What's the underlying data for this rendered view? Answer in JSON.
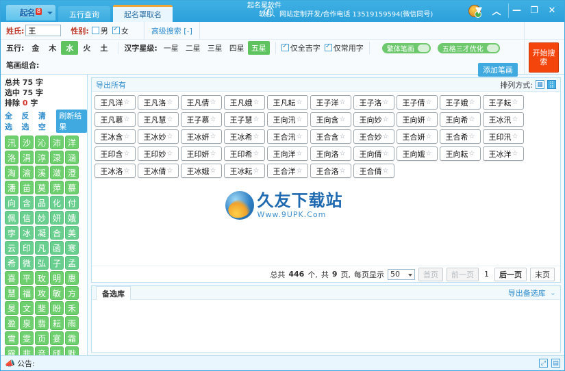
{
  "titlebar": {
    "logo_text": "起名",
    "logo_badge": "8",
    "tabs": [
      {
        "label": "五行查询",
        "active": false
      },
      {
        "label": "起名罩取名",
        "active": true
      }
    ],
    "promo_line1": "起名星软件",
    "promo_line2": "软件、网站定制开发/合作电话 13519159594(微信同号)",
    "phone_icon": "phone-icon",
    "qq_icon": "qq-status-icon",
    "win_buttons": [
      "▼",
      "︿",
      "—",
      "❐",
      "✕"
    ]
  },
  "search": {
    "surname_label": "姓氏:",
    "surname_value": "王",
    "gender_label": "性别:",
    "gender_male": "男",
    "gender_female": "女",
    "male_checked": false,
    "female_checked": true,
    "advanced_label": "高级搜索 [-]",
    "wuxing_label": "五行:",
    "wuxing_options": [
      "金",
      "木",
      "水",
      "火",
      "土"
    ],
    "wuxing_selected": "水",
    "star_label": "汉字星级:",
    "star_options": [
      "一星",
      "二星",
      "三星",
      "四星",
      "五星"
    ],
    "star_selected": "五星",
    "only_lucky": "仅全吉字",
    "only_lucky_checked": true,
    "only_common": "仅常用字",
    "only_common_checked": true,
    "toggle_traditional": "繁体笔画",
    "toggle_wuge": "五格三才优化",
    "stroke_label": "笔画组合:",
    "add_stroke_button": "添加笔画",
    "search_button": "开始搜索"
  },
  "sidebar": {
    "total_label": "总共",
    "total_value": "75",
    "total_unit": "字",
    "selected_label": "选中",
    "selected_value": "75",
    "selected_unit": "字",
    "excluded_label": "排除",
    "excluded_value": "0",
    "excluded_unit": "字",
    "select_all": "全选",
    "invert": "反选",
    "clear": "清空",
    "refresh": "刷新结果",
    "characters": [
      "汛",
      "沙",
      "沁",
      "沛",
      "洋",
      "洛",
      "涓",
      "淳",
      "渌",
      "涵",
      "淘",
      "渝",
      "溪",
      "潋",
      "澄",
      "潘",
      "苗",
      "莫",
      "萍",
      "慕",
      "向",
      "含",
      "品",
      "化",
      "付",
      "佩",
      "信",
      "妙",
      "妍",
      "娥",
      "孛",
      "冰",
      "凝",
      "合",
      "美",
      "云",
      "印",
      "凡",
      "函",
      "寒",
      "希",
      "微",
      "弘",
      "子",
      "孟",
      "喜",
      "平",
      "玫",
      "明",
      "惠",
      "慧",
      "福",
      "攻",
      "敏",
      "方",
      "旻",
      "文",
      "斐",
      "盼",
      "禾",
      "盈",
      "泉",
      "翡",
      "耘",
      "雨",
      "雪",
      "雯",
      "页",
      "宴",
      "霜",
      "露",
      "非",
      "音",
      "颀",
      "默"
    ]
  },
  "results": {
    "export_all": "导出所有",
    "sort_label": "排列方式:",
    "sort_icon_grid": "grid-view-icon",
    "sort_icon_list": "list-view-icon",
    "names": [
      "王凡洋",
      "王凡洛",
      "王凡倩",
      "王凡娥",
      "王凡耘",
      "王子洋",
      "王子洛",
      "王子倩",
      "王子娥",
      "王子耘",
      "王凡慕",
      "王凡慧",
      "王子慕",
      "王子慧",
      "王向汛",
      "王向含",
      "王向妙",
      "王向妍",
      "王向希",
      "王冰汛",
      "王冰含",
      "王冰妙",
      "王冰妍",
      "王冰希",
      "王合汛",
      "王合含",
      "王合妙",
      "王合妍",
      "王合希",
      "王印汛",
      "王印含",
      "王印妙",
      "王印妍",
      "王印希",
      "王向洋",
      "王向洛",
      "王向倩",
      "王向娥",
      "王向耘",
      "王冰洋",
      "王冰洛",
      "王冰倩",
      "王冰娥",
      "王冰耘",
      "王合洋",
      "王合洛",
      "王合倩"
    ],
    "star_glyph": "☆"
  },
  "watermark": {
    "cn": "久友下载站",
    "en": "Www.9UPK.Com"
  },
  "pager": {
    "total_prefix": "总共",
    "total_count": "446",
    "total_unit": "个,",
    "pages_prefix": "共",
    "pages_count": "9",
    "pages_unit": "页,",
    "per_page_label": "每页显示",
    "per_page_value": "50",
    "first": "首页",
    "prev": "前一页",
    "current": "1",
    "next": "后一页",
    "last": "末页"
  },
  "favorites": {
    "tab_label": "备选库",
    "export_label": "导出备选库",
    "collapse_icon": "chevron-down-icon"
  },
  "statusbar": {
    "announce_icon": "megaphone-icon",
    "announce_label": "公告:",
    "right_icons": [
      "resize-icon",
      "panel-icon"
    ]
  },
  "colors": {
    "brand": "#3fb0e3",
    "accent_green": "#5fc45f",
    "accent_red": "#f4450d",
    "link": "#2e8ccd"
  }
}
